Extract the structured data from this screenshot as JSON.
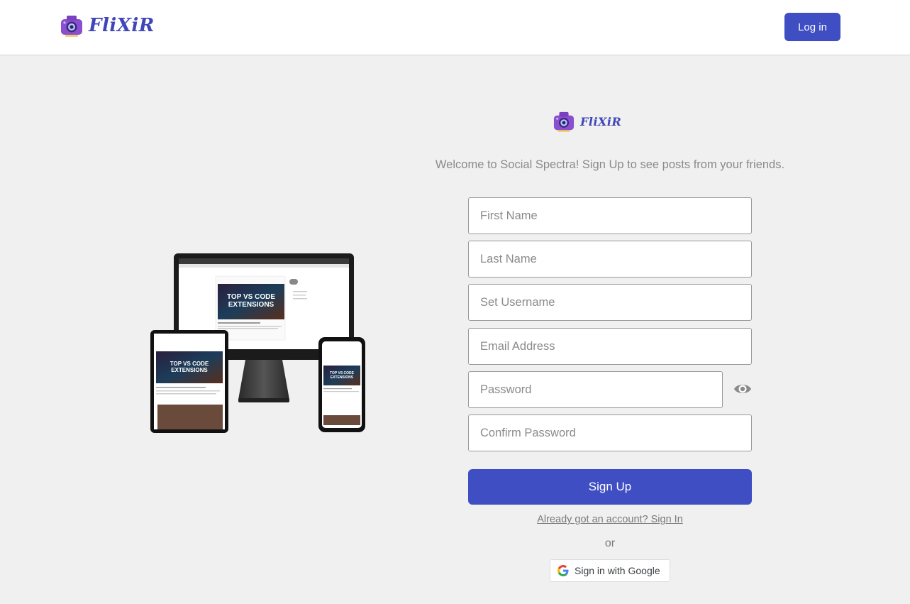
{
  "header": {
    "brand": "FliXiR",
    "login_label": "Log in"
  },
  "main": {
    "logo_text": "FliXiR",
    "welcome": "Welcome to Social Spectra! Sign Up to see posts from your friends.",
    "fields": {
      "first_name": "First Name",
      "last_name": "Last Name",
      "username": "Set Username",
      "email": "Email Address",
      "password": "Password",
      "confirm_password": "Confirm Password"
    },
    "signup_label": "Sign Up",
    "signin_link": "Already got an account? Sign In",
    "or_text": "or",
    "google_label": "Sign in with Google"
  },
  "mockup": {
    "headline_line1": "TOP VS CODE",
    "headline_line2": "EXTENSIONS"
  },
  "colors": {
    "accent": "#3f4ec3",
    "brand_text": "#3f46b8",
    "background": "#f0f0f0"
  },
  "icons": [
    "camera-logo-icon",
    "eye-icon",
    "google-g-icon"
  ]
}
